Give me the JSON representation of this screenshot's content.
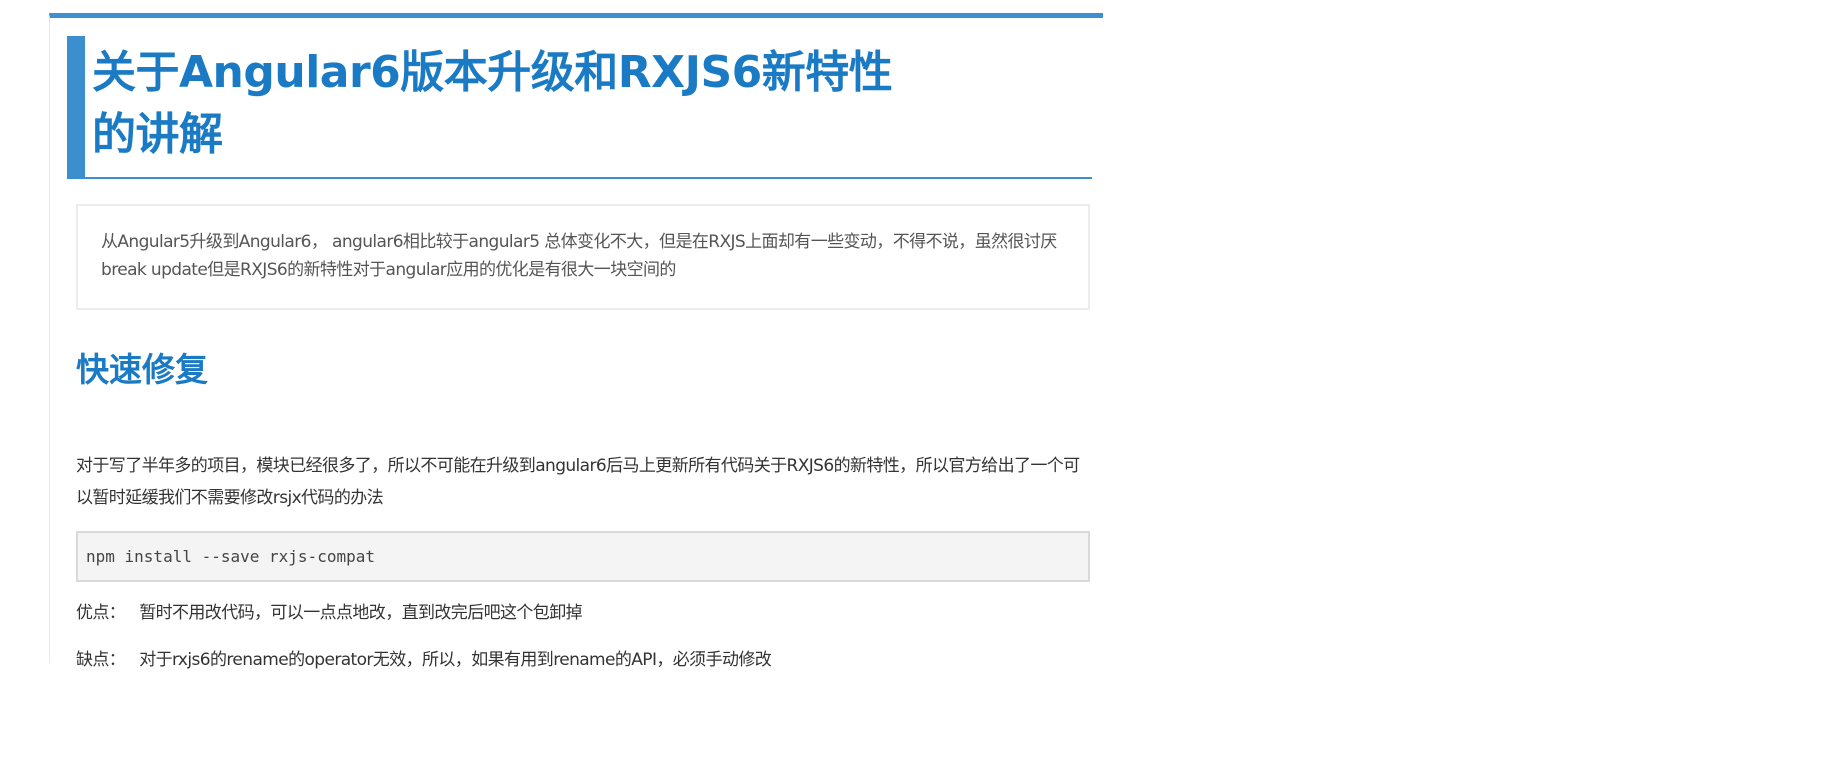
{
  "article": {
    "title": "关于Angular6版本升级和RXJS6新特性的讲解",
    "summary": "从Angular5升级到Angular6， angular6相比较于angular5 总体变化不大，但是在RXJS上面却有一些变动，不得不说，虽然很讨厌break update但是RXJS6的新特性对于angular应用的优化是有很大一块空间的",
    "sections": [
      {
        "heading": "快速修复",
        "paragraph": "对于写了半年多的项目，模块已经很多了，所以不可能在升级到angular6后马上更新所有代码关于RXJS6的新特性，所以官方给出了一个可以暂时延缓我们不需要修改rsjx代码的办法",
        "code": "npm install --save rxjs-compat",
        "pros_label": "优点：",
        "pros_text": "暂时不用改代码，可以一点点地改，直到改完后吧这个包卸掉",
        "cons_label": "缺点：",
        "cons_text": "对于rxjs6的rename的operator无效，所以，如果有用到rename的API，必须手动修改"
      }
    ]
  },
  "colors": {
    "accent": "#1a7bc4",
    "accent_bar": "#3b8fcf",
    "code_bg": "#f4f4f4",
    "text": "#333333",
    "muted_text": "#555555"
  }
}
